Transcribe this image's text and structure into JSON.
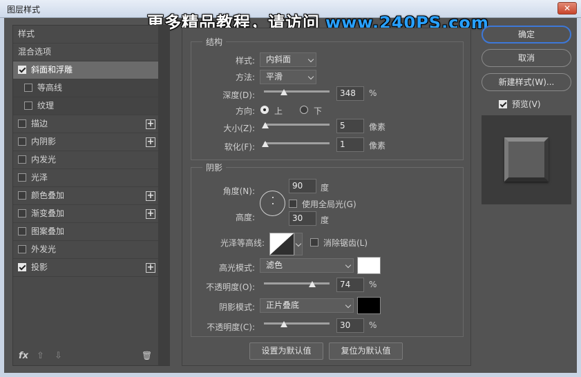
{
  "window": {
    "title": "图层样式",
    "close_glyph": "✕"
  },
  "watermark": {
    "text": "更多精品教程，请访问",
    "url": "www.240PS.com"
  },
  "left_list": {
    "items": [
      {
        "label": "样式"
      },
      {
        "label": "混合选项"
      },
      {
        "label": "斜面和浮雕",
        "checked": true
      },
      {
        "label": "等高线",
        "checked": false
      },
      {
        "label": "纹理",
        "checked": false
      },
      {
        "label": "描边",
        "checked": false
      },
      {
        "label": "内阴影",
        "checked": false
      },
      {
        "label": "内发光",
        "checked": false
      },
      {
        "label": "光泽",
        "checked": false
      },
      {
        "label": "颜色叠加",
        "checked": false
      },
      {
        "label": "渐变叠加",
        "checked": false
      },
      {
        "label": "图案叠加",
        "checked": false
      },
      {
        "label": "外发光",
        "checked": false
      },
      {
        "label": "投影",
        "checked": true
      }
    ],
    "plus_glyph": "+",
    "footer": {
      "fx": "fx",
      "up": "⇧",
      "down": "⇩",
      "trash": "🗑"
    }
  },
  "structure": {
    "title": "结构",
    "style_label": "样式:",
    "style_value": "内斜面",
    "technique_label": "方法:",
    "technique_value": "平滑",
    "depth_label": "深度(D):",
    "depth_value": "348",
    "depth_unit": "%",
    "depth_level": 0.3,
    "direction_label": "方向:",
    "dir_up": "上",
    "dir_down": "下",
    "size_label": "大小(Z):",
    "size_value": "5",
    "size_unit": "像素",
    "size_level": 0.02,
    "soften_label": "软化(F):",
    "soften_value": "1",
    "soften_unit": "像素",
    "soften_level": 0.02
  },
  "shading": {
    "title": "阴影",
    "angle_label": "角度(N):",
    "angle_value": "90",
    "angle_unit": "度",
    "global_light_label": "使用全局光(G)",
    "altitude_label": "高度:",
    "altitude_value": "30",
    "altitude_unit": "度",
    "gloss_label": "光泽等高线:",
    "anti_alias_label": "消除锯齿(L)",
    "highlight_mode_label": "高光模式:",
    "highlight_mode_value": "滤色",
    "highlight_color": "#ffffff",
    "hl_opacity_label": "不透明度(O):",
    "hl_opacity_value": "74",
    "hl_opacity_unit": "%",
    "hl_opacity_level": 0.74,
    "shadow_mode_label": "阴影模式:",
    "shadow_mode_value": "正片叠底",
    "shadow_color": "#000000",
    "sh_opacity_label": "不透明度(C):",
    "sh_opacity_value": "30",
    "sh_opacity_unit": "%",
    "sh_opacity_level": 0.3
  },
  "bottom_buttons": {
    "set_default": "设置为默认值",
    "reset_default": "复位为默认值"
  },
  "right": {
    "ok": "确定",
    "cancel": "取消",
    "new_style": "新建样式(W)...",
    "preview_label": "预览(V)",
    "preview_checked": true
  }
}
